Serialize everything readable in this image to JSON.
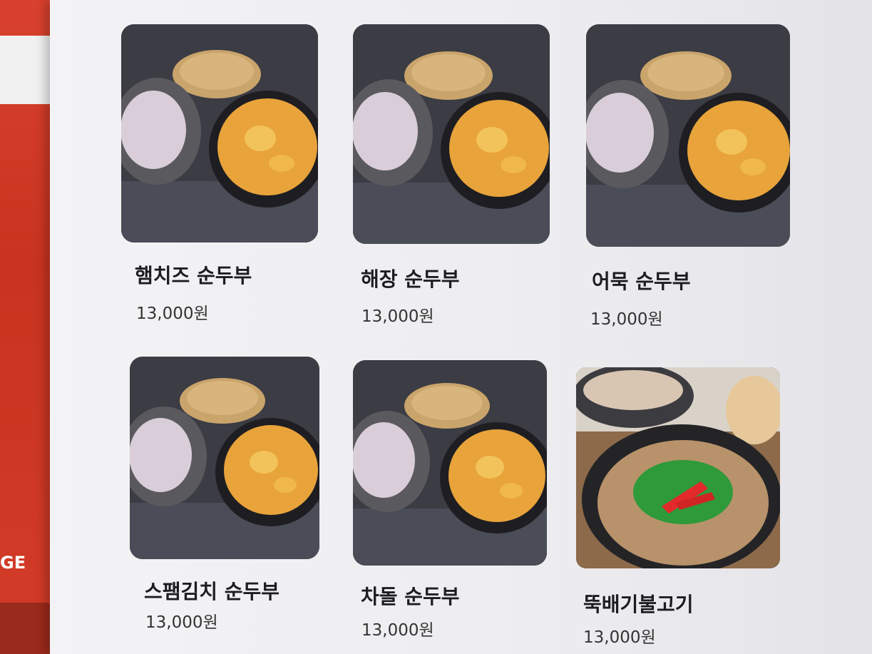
{
  "sidebar": {
    "partial_label": "GE"
  },
  "menu": [
    {
      "name": "햄치즈 순두부",
      "price": "13,000원",
      "image": "sundubu-icon"
    },
    {
      "name": "해장 순두부",
      "price": "13,000원",
      "image": "sundubu-icon"
    },
    {
      "name": "어묵 순두부",
      "price": "13,000원",
      "image": "sundubu-icon"
    },
    {
      "name": "스팸김치 순두부",
      "price": "13,000원",
      "image": "sundubu-icon"
    },
    {
      "name": "차돌 순두부",
      "price": "13,000원",
      "image": "sundubu-icon"
    },
    {
      "name": "뚝배기불고기",
      "price": "13,000원",
      "image": "bulgogi-icon"
    }
  ],
  "colors": {
    "brand_red": "#d23b28",
    "stew_orange": "#e8a33a"
  }
}
